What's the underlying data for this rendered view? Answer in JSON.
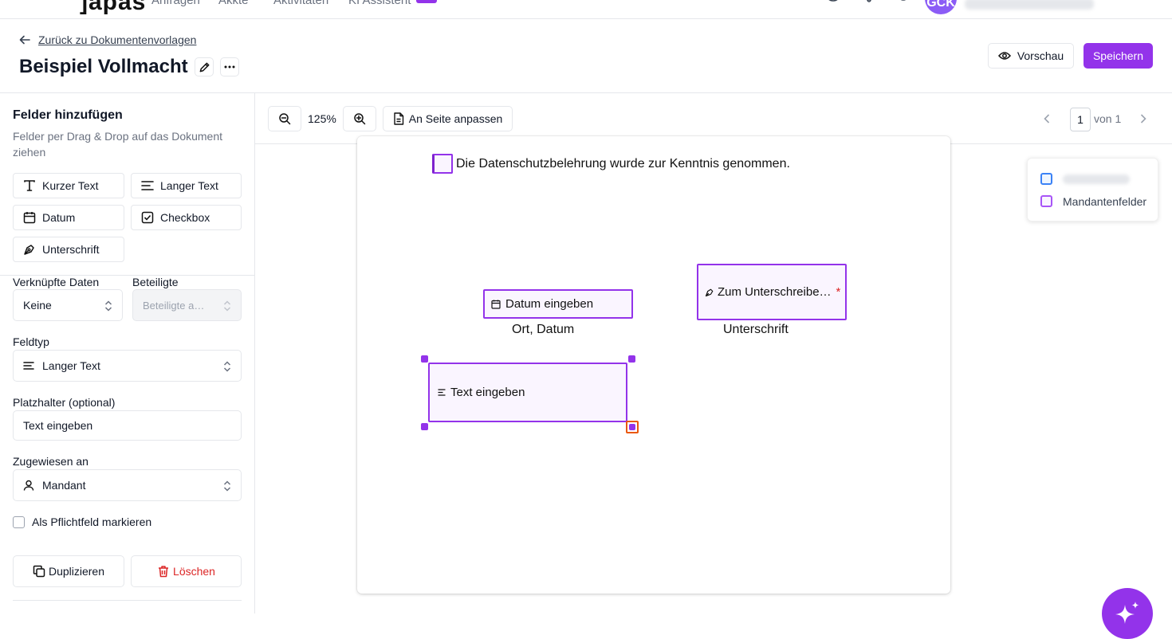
{
  "nav": {
    "logo": "]apas",
    "items": [
      "Anfragen",
      "Akkte",
      "Aktivitäten",
      "KI Assistent"
    ],
    "avatar_initials": "GCK"
  },
  "header": {
    "back_label": "Zurück zu Dokumentenvorlagen",
    "title": "Beispiel Vollmacht",
    "preview_label": "Vorschau",
    "save_label": "Speichern"
  },
  "sidebar": {
    "title": "Felder hinzufügen",
    "description": "Felder per Drag & Drop auf das Dokument ziehen",
    "field_buttons": [
      "Kurzer Text",
      "Langer Text",
      "Datum",
      "Checkbox",
      "Unterschrift"
    ],
    "linked_data_label": "Verknüpfte Daten",
    "linked_data_value": "Keine",
    "participants_label": "Beteiligte",
    "participants_placeholder": "Beteiligte a…",
    "field_type_label": "Feldtyp",
    "field_type_value": "Langer Text",
    "placeholder_label": "Platzhalter (optional)",
    "placeholder_value": "Text eingeben",
    "assigned_label": "Zugewiesen an",
    "assigned_value": "Mandant",
    "required_label": "Als Pflichtfeld markieren",
    "required_checked": false,
    "duplicate_label": "Duplizieren",
    "delete_label": "Löschen"
  },
  "toolbar": {
    "zoom": "125%",
    "fit_label": "An Seite anpassen",
    "page_current": "1",
    "page_of": "von 1"
  },
  "document": {
    "checkbox_text": "Die Datenschutzbelehrung wurde zur Kenntnis genommen.",
    "date_field_label": "Datum eingeben",
    "date_caption": "Ort, Datum",
    "signature_field_label": "Zum Unterschreibe…",
    "signature_required_mark": "*",
    "signature_caption": "Unterschrift",
    "text_field_label": "Text eingeben"
  },
  "legend": {
    "items": [
      {
        "label": "",
        "color": "#3b82f6"
      },
      {
        "label": "Mandantenfelder",
        "color": "#a855f7"
      }
    ]
  },
  "colors": {
    "accent": "#9333ea",
    "danger": "#dc2626",
    "border": "#e5e7eb"
  }
}
